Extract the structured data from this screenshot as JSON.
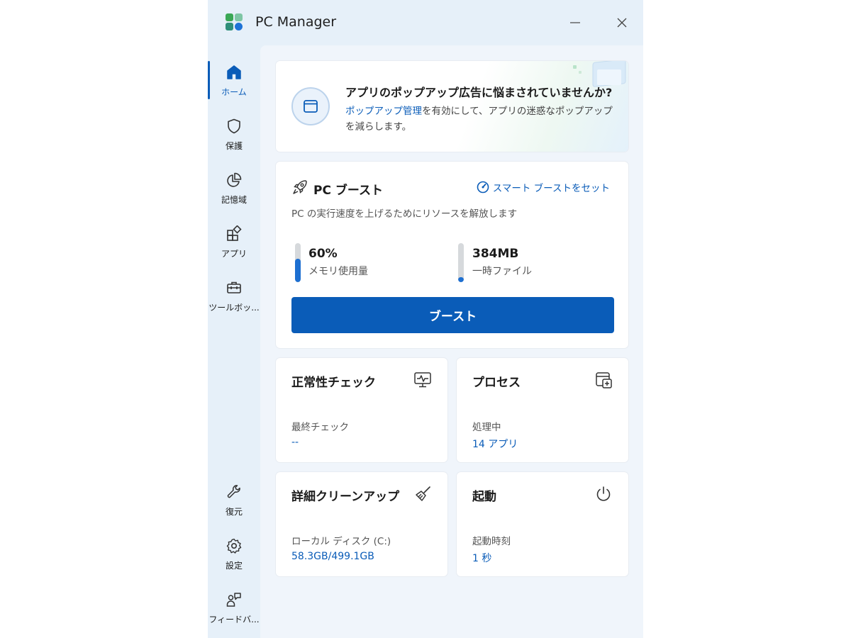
{
  "app": {
    "title": "PC Manager"
  },
  "sidebar": {
    "top_items": [
      {
        "label": "ホーム",
        "icon": "home-icon",
        "active": true
      },
      {
        "label": "保護",
        "icon": "shield-icon"
      },
      {
        "label": "記憶域",
        "icon": "pie-chart-icon"
      },
      {
        "label": "アプリ",
        "icon": "apps-icon"
      },
      {
        "label": "ツールボッ...",
        "icon": "toolbox-icon"
      }
    ],
    "bottom_items": [
      {
        "label": "復元",
        "icon": "wrench-icon"
      },
      {
        "label": "設定",
        "icon": "gear-icon"
      },
      {
        "label": "フィードバ...",
        "icon": "feedback-icon"
      }
    ]
  },
  "promo": {
    "title": "アプリのポップアップ広告に悩まされていませんか?",
    "link": "ポップアップ管理",
    "desc": "を有効にして、アプリの迷惑なポップアップを減らします。"
  },
  "boost": {
    "title": "PC ブースト",
    "smart_link": "スマート ブーストをセット",
    "desc": "PC の実行速度を上げるためにリソースを解放します",
    "memory": {
      "value": "60%",
      "label": "メモリ使用量",
      "fill_fraction": 0.6
    },
    "temp": {
      "value": "384MB",
      "label": "一時ファイル",
      "fill_fraction": 0.12
    },
    "button": "ブースト"
  },
  "tiles": {
    "health": {
      "title": "正常性チェック",
      "sub": "最終チェック",
      "value": "--",
      "icon": "monitor-pulse-icon"
    },
    "process": {
      "title": "プロセス",
      "sub": "処理中",
      "value": "14 アプリ",
      "icon": "window-add-icon"
    },
    "cleanup": {
      "title": "詳細クリーンアップ",
      "sub": "ローカル ディスク (C:)",
      "value": "58.3GB/499.1GB",
      "icon": "broom-icon"
    },
    "startup": {
      "title": "起動",
      "sub": "起動時刻",
      "value": "1 秒",
      "icon": "power-icon"
    }
  },
  "colors": {
    "accent": "#0a5cb8",
    "window_bg": "#e6f0f9",
    "content_bg": "#f0f5fb"
  }
}
